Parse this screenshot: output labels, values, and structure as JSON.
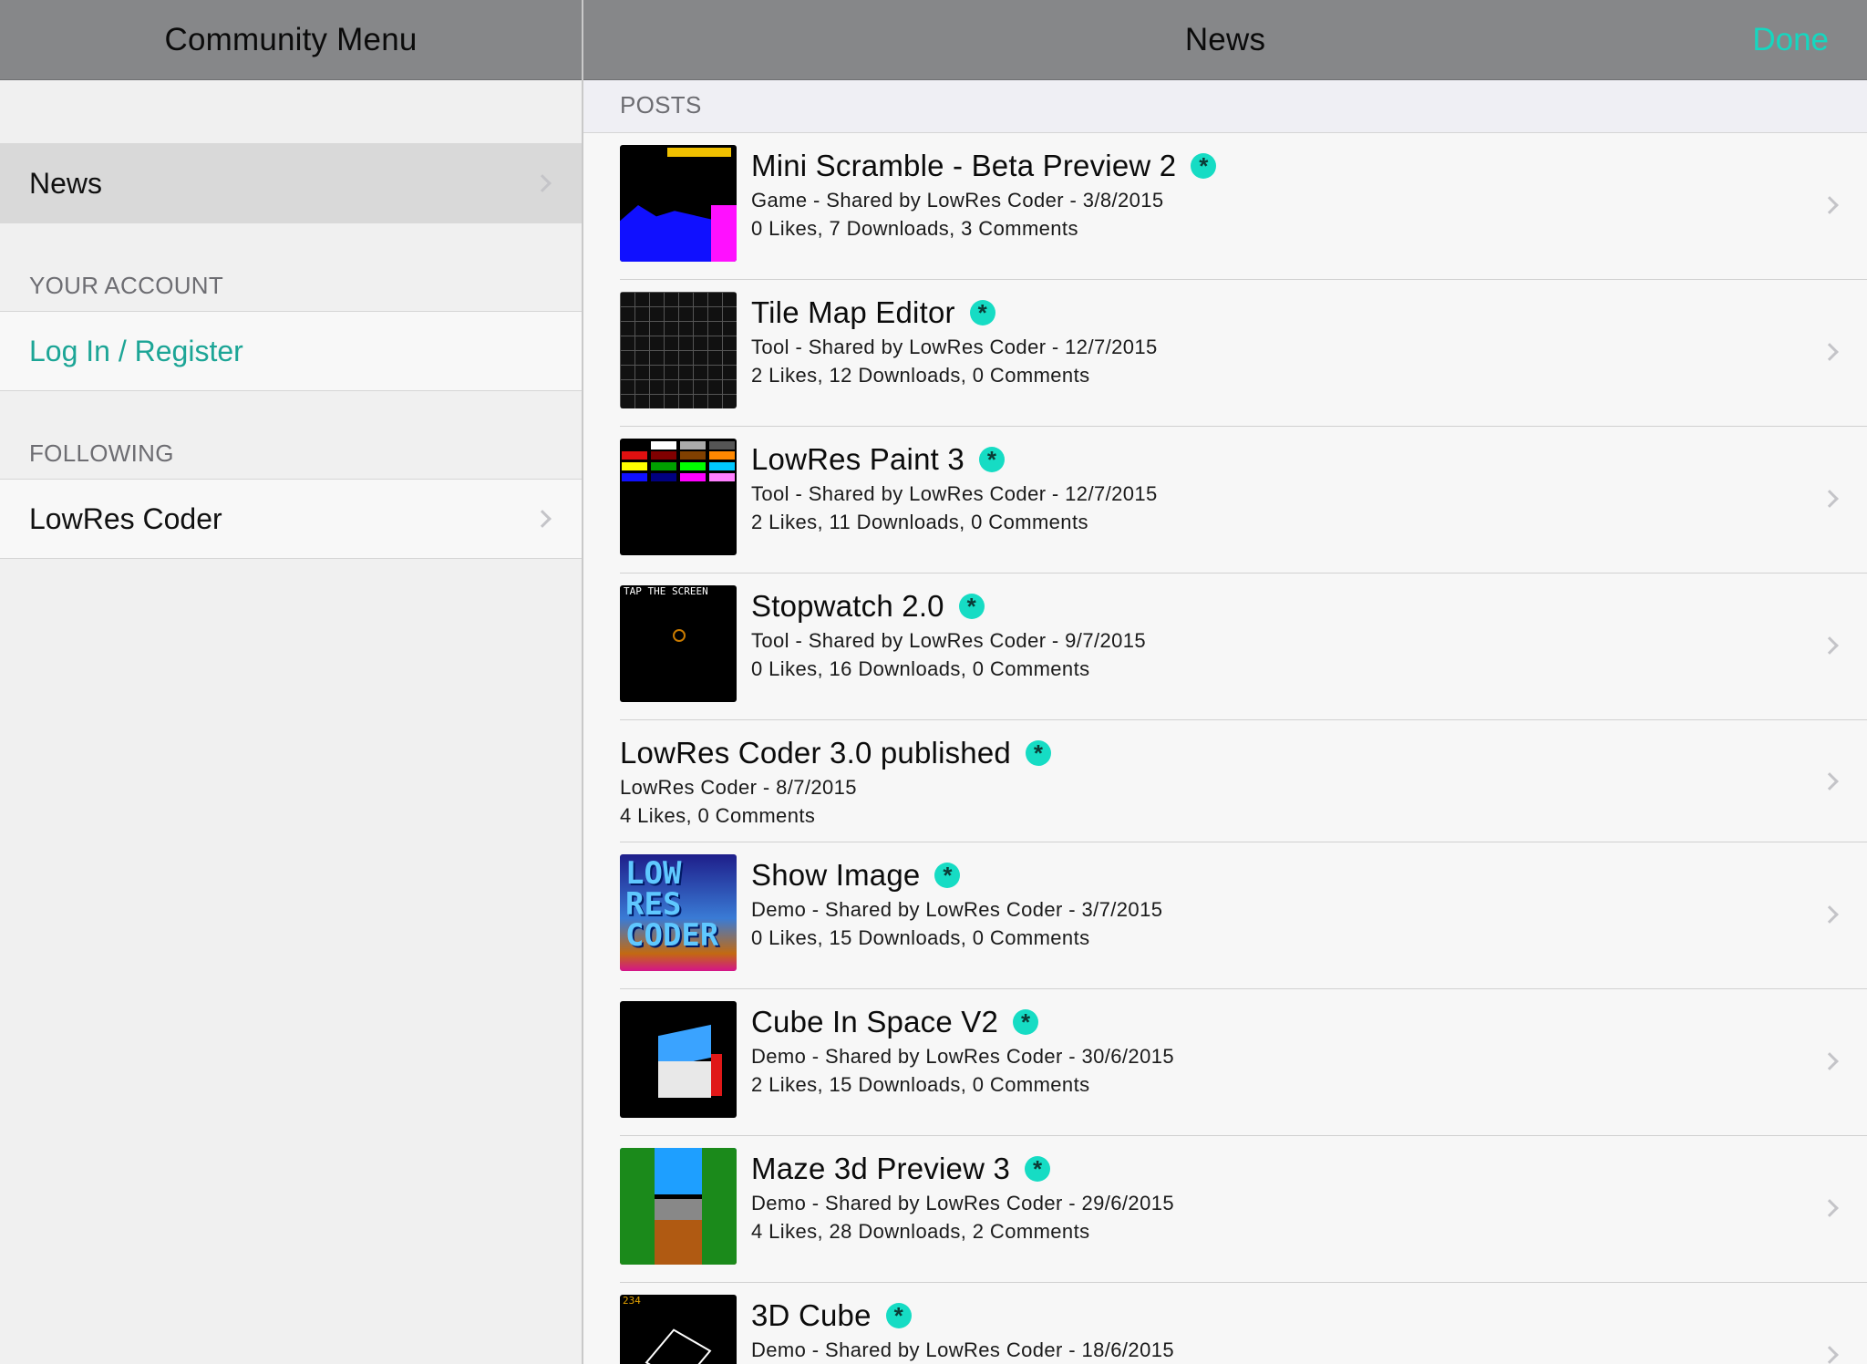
{
  "master": {
    "title": "Community Menu",
    "news_label": "News",
    "account_header": "YOUR ACCOUNT",
    "login_label": "Log In / Register",
    "following_header": "FOLLOWING",
    "following_items": [
      "LowRes Coder"
    ]
  },
  "detail": {
    "title": "News",
    "done_label": "Done",
    "section_header": "POSTS",
    "posts": [
      {
        "title": "Mini Scramble - Beta Preview 2",
        "subtitle": "Game - Shared by LowRes Coder - 3/8/2015",
        "stats": "0 Likes, 7 Downloads, 3 Comments"
      },
      {
        "title": "Tile Map Editor",
        "subtitle": "Tool - Shared by LowRes Coder - 12/7/2015",
        "stats": "2 Likes, 12 Downloads, 0 Comments"
      },
      {
        "title": "LowRes Paint 3",
        "subtitle": "Tool - Shared by LowRes Coder - 12/7/2015",
        "stats": "2 Likes, 11 Downloads, 0 Comments"
      },
      {
        "title": "Stopwatch 2.0",
        "subtitle": "Tool - Shared by LowRes Coder - 9/7/2015",
        "stats": "0 Likes, 16 Downloads, 0 Comments"
      },
      {
        "title": "LowRes Coder 3.0 published",
        "subtitle": "LowRes Coder - 8/7/2015",
        "stats": "4 Likes, 0 Comments"
      },
      {
        "title": "Show Image",
        "subtitle": "Demo - Shared by LowRes Coder - 3/7/2015",
        "stats": "0 Likes, 15 Downloads, 0 Comments"
      },
      {
        "title": "Cube In Space V2",
        "subtitle": "Demo - Shared by LowRes Coder - 30/6/2015",
        "stats": "2 Likes, 15 Downloads, 0 Comments"
      },
      {
        "title": "Maze 3d Preview 3",
        "subtitle": "Demo - Shared by LowRes Coder - 29/6/2015",
        "stats": "4 Likes, 28 Downloads, 2 Comments"
      },
      {
        "title": "3D Cube",
        "subtitle": "Demo - Shared by LowRes Coder - 18/6/2015",
        "stats": ""
      }
    ],
    "thumb_text": {
      "stopwatch": "TAP THE SCREEN",
      "show_image": "LOW RES CODER",
      "cube_3d": "234"
    }
  },
  "colors": {
    "accent": "#1ca596",
    "done": "#15d7c0",
    "star": "#16dcc4",
    "navbar": "#868789"
  },
  "icons": {
    "chevron": "chevron-right-icon",
    "new_badge": "new-star-icon"
  }
}
